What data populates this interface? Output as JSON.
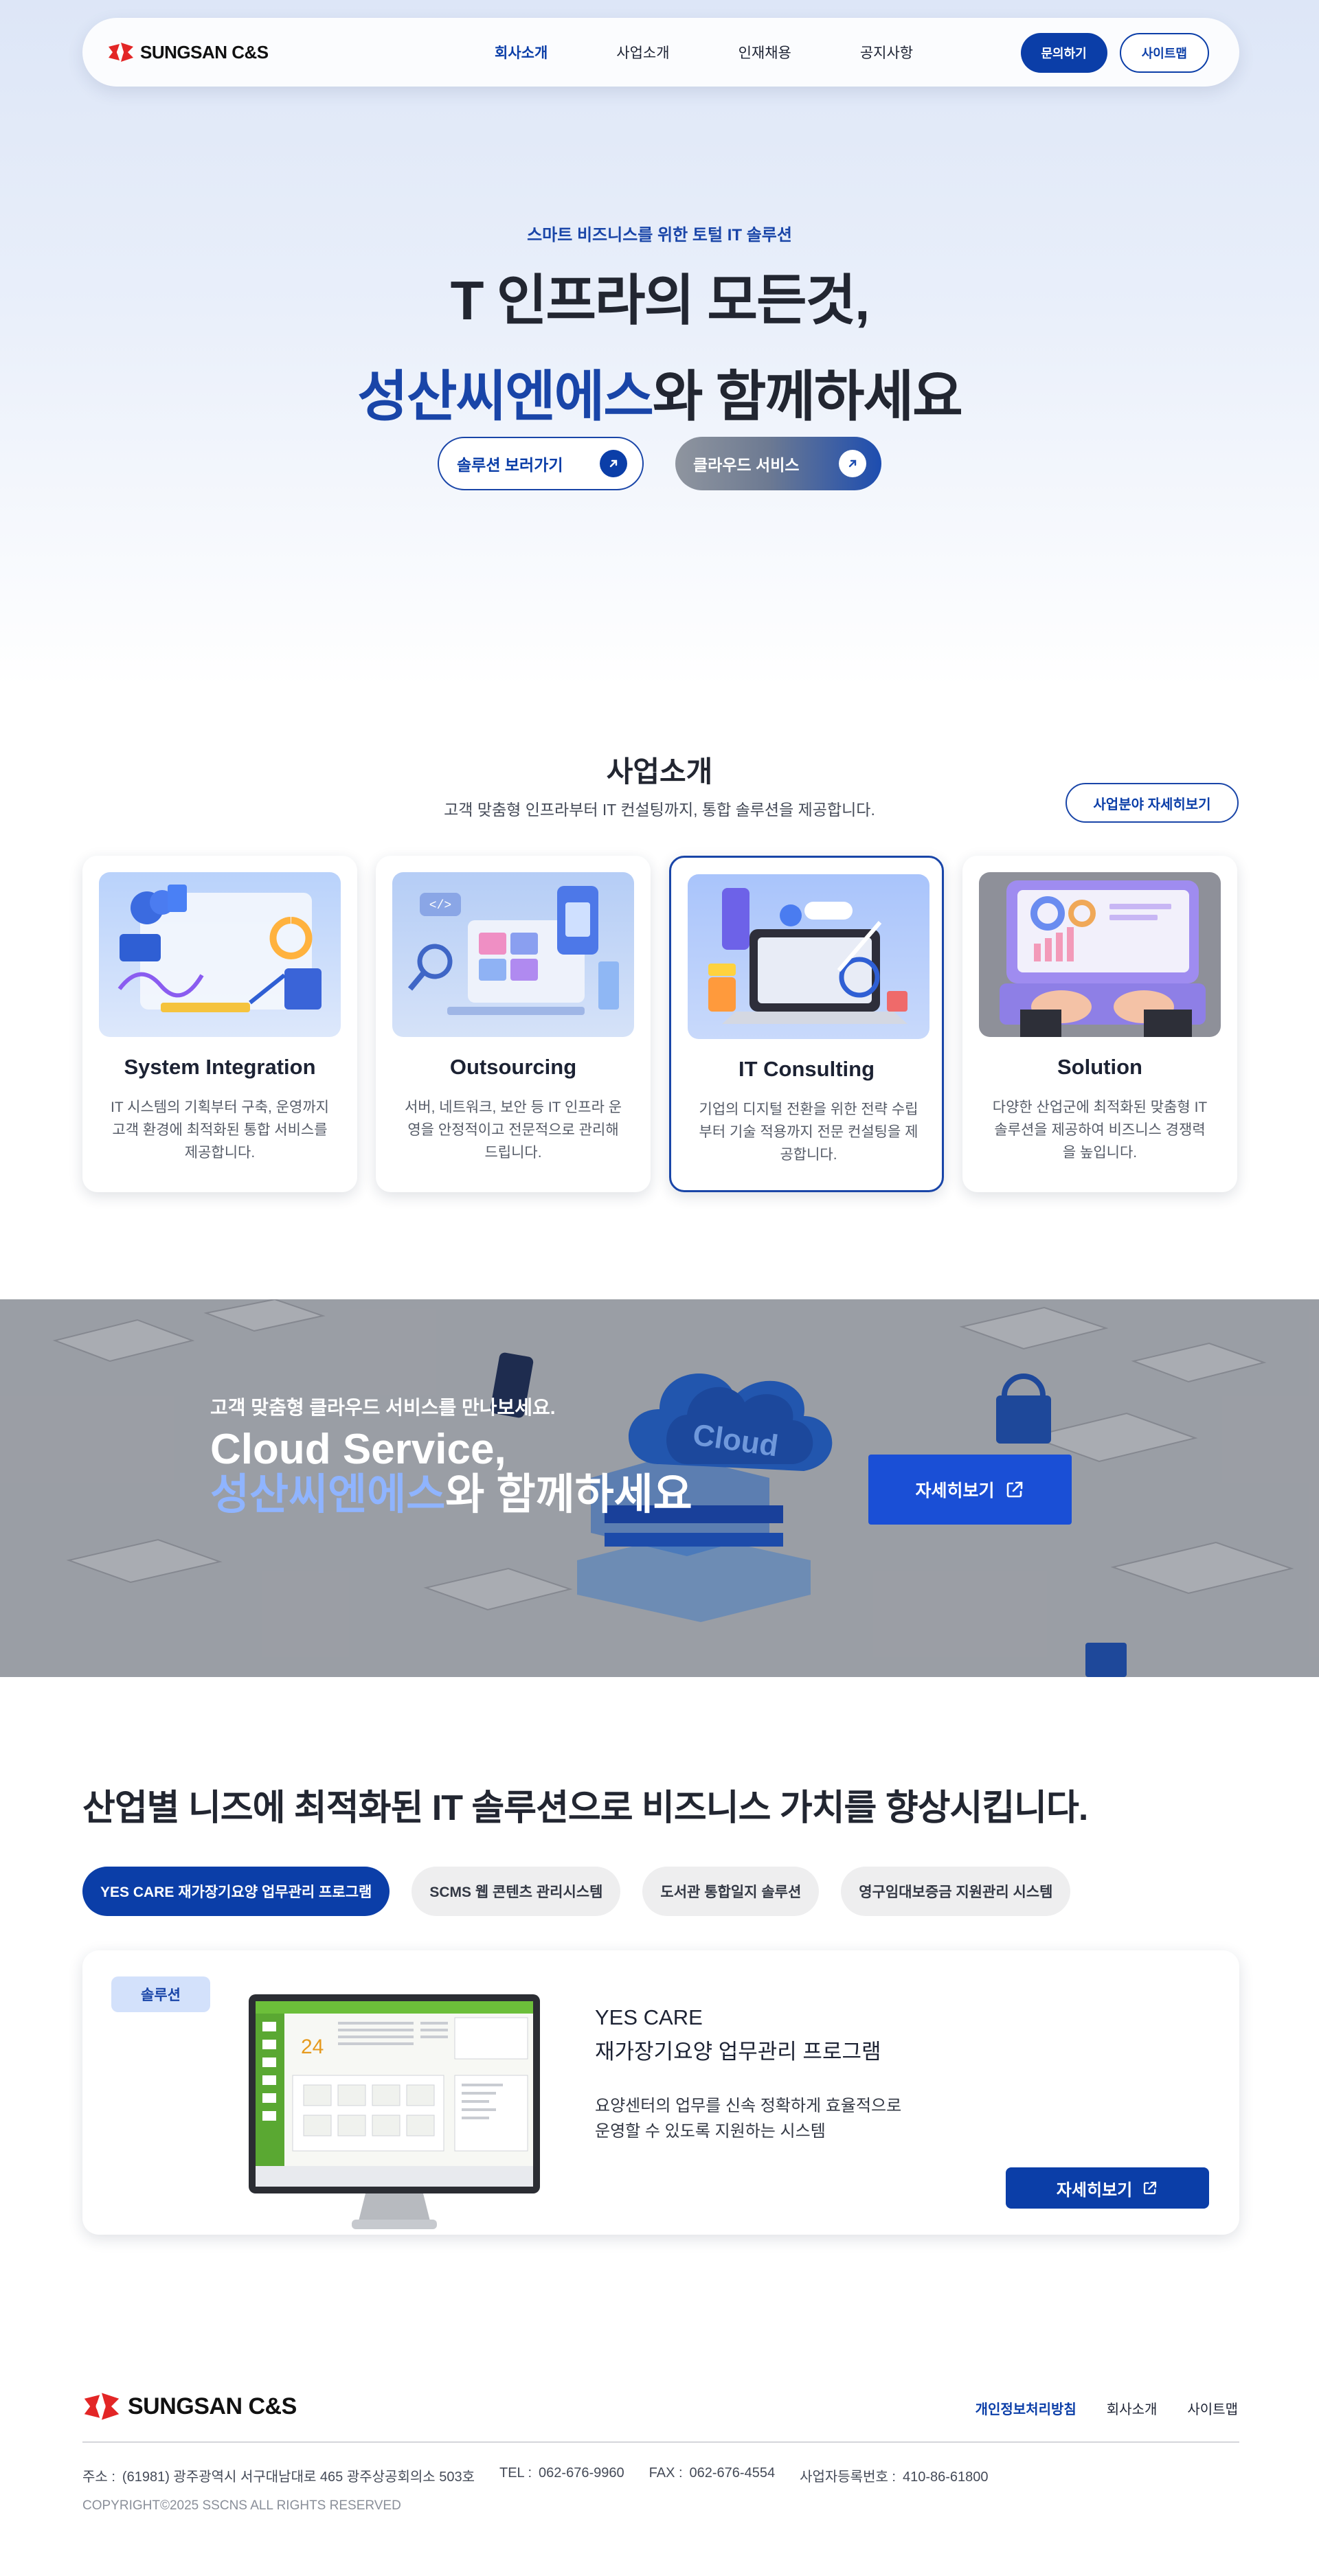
{
  "brand": {
    "name": "SUNGSAN C&S"
  },
  "nav": [
    {
      "label": "회사소개",
      "active": true
    },
    {
      "label": "사업소개",
      "active": false
    },
    {
      "label": "인재채용",
      "active": false
    },
    {
      "label": "공지사항",
      "active": false
    }
  ],
  "header_buttons": {
    "contact": "문의하기",
    "sitemap": "사이트맵"
  },
  "hero": {
    "kicker": "스마트 비즈니스를 위한 토털 IT 솔루션",
    "title_line1": "T 인프라의 모든것,",
    "title_accent": "성산씨엔에스",
    "title_line2_rest": "와 함께하세요",
    "btn_solution": "솔루션 보러가기",
    "btn_cloud": "클라우드 서비스"
  },
  "business": {
    "title": "사업소개",
    "subtitle": "고객 맞춤형 인프라부터 IT 컨설팅까지, 통합 솔루션을 제공합니다.",
    "more_label": "사업분야 자세히보기",
    "cards": [
      {
        "title": "System Integration",
        "desc": "IT 시스템의 기획부터 구축, 운영까지 고객 환경에 최적화된 통합 서비스를 제공합니다.",
        "selected": false
      },
      {
        "title": "Outsourcing",
        "desc": "서버, 네트워크, 보안 등 IT 인프라 운영을 안정적이고 전문적으로 관리해드립니다.",
        "selected": false
      },
      {
        "title": "IT Consulting",
        "desc": "기업의 디지털 전환을 위한 전략 수립부터 기술 적용까지 전문 컨설팅을 제공합니다.",
        "selected": true
      },
      {
        "title": "Solution",
        "desc": "다양한 산업군에 최적화된 맞춤형 IT 솔루션을 제공하여 비즈니스 경쟁력을 높입니다.",
        "selected": false
      }
    ]
  },
  "cloud": {
    "kicker": "고객 맞춤형 클라우드 서비스를 만나보세요.",
    "title_line1": "Cloud Service,",
    "title_accent": "성산씨엔에스",
    "title_line2_rest": "와 함께하세요",
    "btn": "자세히보기",
    "image_text": "Cloud"
  },
  "solutions": {
    "title": "산업별 니즈에 최적화된 IT 솔루션으로 비즈니스 가치를 향상시킵니다.",
    "tabs": [
      {
        "label": "YES CARE 재가장기요양 업무관리 프로그램",
        "active": true
      },
      {
        "label": "SCMS 웹 콘텐츠 관리시스템",
        "active": false
      },
      {
        "label": "도서관 통합일지 솔루션",
        "active": false
      },
      {
        "label": "영구임대보증금 지원관리 시스템",
        "active": false
      }
    ],
    "card": {
      "badge": "솔루션",
      "name_line1": "YES CARE",
      "name_line2": "재가장기요양 업무관리 프로그램",
      "desc_line1": "요양센터의 업무를 신속 정확하게 효율적으로",
      "desc_line2": "운영할 수 있도록 지원하는 시스템",
      "btn": "자세히보기",
      "screen_number": "24"
    }
  },
  "footer": {
    "links": [
      {
        "label": "개인정보처리방침",
        "primary": true
      },
      {
        "label": "회사소개",
        "primary": false
      },
      {
        "label": "사이트맵",
        "primary": false
      }
    ],
    "address_label": "주소 :",
    "address": "(61981) 광주광역시 서구대남대로 465 광주상공회의소 503호",
    "tel_label": "TEL :",
    "tel": "062-676-9960",
    "fax_label": "FAX :",
    "fax": "062-676-4554",
    "biz_label": "사업자등록번호 :",
    "biz_no": "410-86-61800",
    "copyright": "COPYRIGHT©2025 SSCNS ALL RIGHTS RESERVED"
  },
  "colors": {
    "primary": "#0b3ea8",
    "accent": "#1945a8",
    "cloud_accent": "#8fb4ff",
    "logo_red": "#e32626"
  }
}
